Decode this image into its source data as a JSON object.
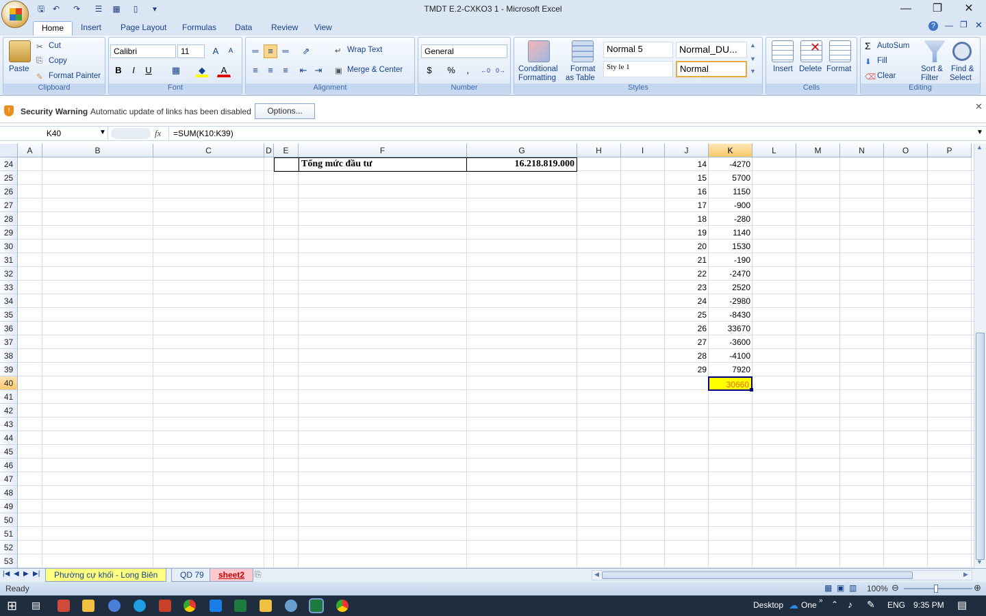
{
  "window": {
    "title": "TMDT E.2-CXKO3 1 - Microsoft Excel"
  },
  "ribbon_tabs": [
    "Home",
    "Insert",
    "Page Layout",
    "Formulas",
    "Data",
    "Review",
    "View"
  ],
  "clipboard": {
    "paste": "Paste",
    "cut": "Cut",
    "copy": "Copy",
    "format_painter": "Format Painter",
    "label": "Clipboard"
  },
  "font": {
    "name": "Calibri",
    "size": "11",
    "bold": "B",
    "italic": "I",
    "underline": "U",
    "label": "Font"
  },
  "alignment": {
    "wrap_text": "Wrap Text",
    "merge_center": "Merge & Center",
    "label": "Alignment"
  },
  "number": {
    "format": "General",
    "currency": "$",
    "percent": "%",
    "comma": ",",
    "label": "Number"
  },
  "styles": {
    "conditional": "Conditional",
    "formatting": "Formatting",
    "format": "Format",
    "as_table": "as Table",
    "normal5": "Normal 5",
    "normal_du": "Normal_DU...",
    "style1": "Sty le 1",
    "normal": "Normal",
    "label": "Styles"
  },
  "cells": {
    "insert": "Insert",
    "delete": "Delete",
    "format": "Format",
    "label": "Cells"
  },
  "editing": {
    "autosum": "AutoSum",
    "fill": "Fill",
    "clear": "Clear",
    "sort": "Sort &",
    "filter": "Filter",
    "find": "Find &",
    "select": "Select",
    "label": "Editing"
  },
  "security": {
    "title": "Security Warning",
    "message": "Automatic update of links has been disabled",
    "options": "Options..."
  },
  "formula_bar": {
    "name_box": "K40",
    "fx": "fx",
    "formula": "=SUM(K10:K39)"
  },
  "columns": [
    "A",
    "B",
    "C",
    "D",
    "E",
    "F",
    "G",
    "H",
    "I",
    "J",
    "K",
    "L",
    "M",
    "N",
    "O",
    "P"
  ],
  "rows": [
    "24",
    "25",
    "26",
    "27",
    "28",
    "29",
    "30",
    "31",
    "32",
    "33",
    "34",
    "35",
    "36",
    "37",
    "38",
    "39",
    "40",
    "41",
    "42",
    "43",
    "44",
    "45",
    "46",
    "47",
    "48",
    "49",
    "50",
    "51",
    "52",
    "53"
  ],
  "sheet": {
    "f24": "Tổng mức đầu tư",
    "g24": "16.218.819.000",
    "j_values": [
      "14",
      "15",
      "16",
      "17",
      "18",
      "19",
      "20",
      "21",
      "22",
      "23",
      "24",
      "25",
      "26",
      "27",
      "28",
      "29"
    ],
    "k_values": [
      "-4270",
      "5700",
      "1150",
      "-900",
      "-280",
      "1140",
      "1530",
      "-190",
      "-2470",
      "2520",
      "-2980",
      "-8430",
      "33670",
      "-3600",
      "-4100",
      "7920"
    ],
    "k40": "30660"
  },
  "sheet_tabs": [
    "Phường cự khối - Long Biên",
    "QD 79",
    "sheet2"
  ],
  "status": {
    "ready": "Ready",
    "zoom": "100%"
  },
  "taskbar": {
    "desktop": "Desktop",
    "onedrive": "One",
    "lang": "ENG",
    "time": "9:35 PM"
  }
}
